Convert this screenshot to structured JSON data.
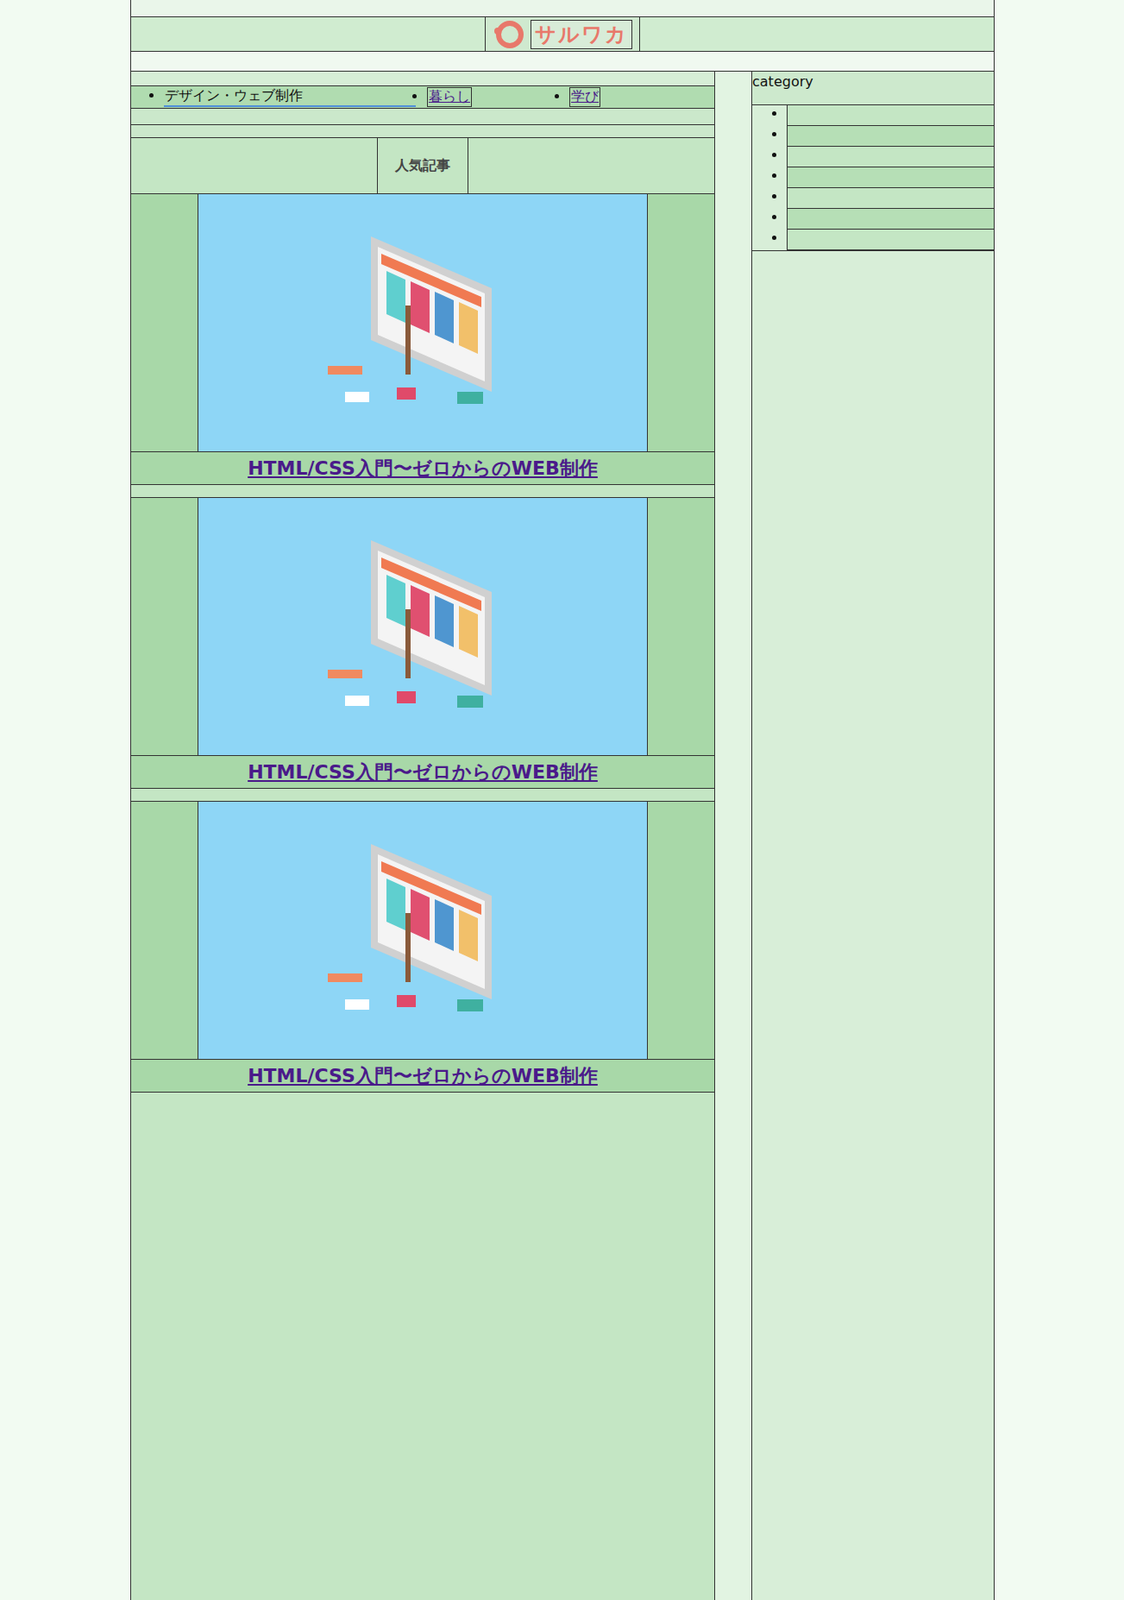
{
  "logo": {
    "text": "サルワカ"
  },
  "nav": {
    "items": [
      {
        "label": "デザイン・ウェブ制作",
        "selected": true
      },
      {
        "label": "暮らし",
        "selected": false
      },
      {
        "label": "学び",
        "selected": false
      }
    ]
  },
  "popular": {
    "heading": "人気記事",
    "articles": [
      {
        "title": "HTML/CSS入門〜ゼロからのWEB制作"
      },
      {
        "title": "HTML/CSS入門〜ゼロからのWEB制作"
      },
      {
        "title": "HTML/CSS入門〜ゼロからのWEB制作"
      }
    ]
  },
  "sidebar": {
    "heading": "category",
    "items": [
      {
        "label": ""
      },
      {
        "label": ""
      },
      {
        "label": ""
      },
      {
        "label": ""
      },
      {
        "label": ""
      },
      {
        "label": ""
      },
      {
        "label": ""
      }
    ]
  }
}
